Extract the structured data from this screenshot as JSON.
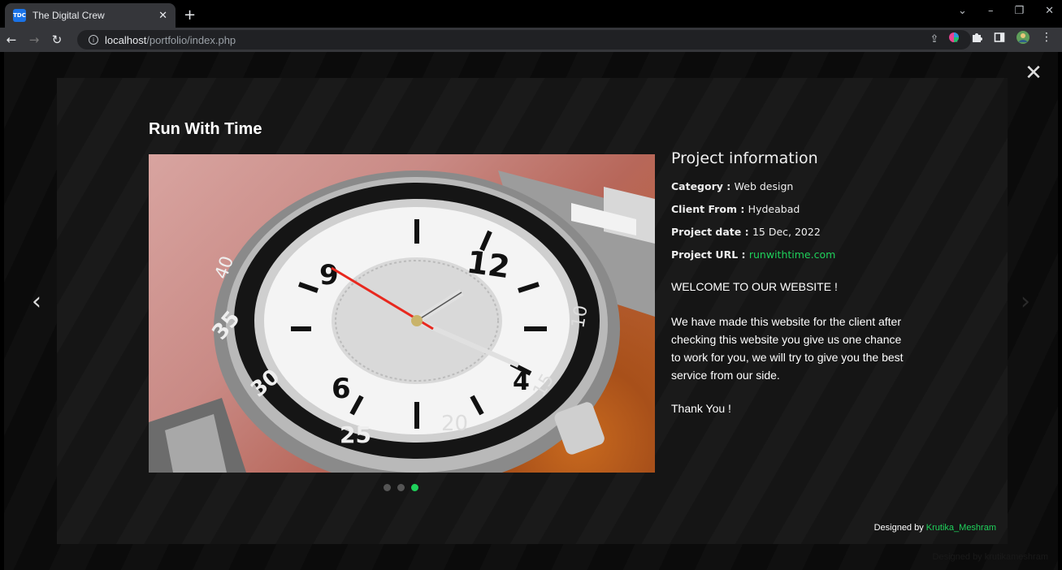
{
  "browser": {
    "tab_title": "The Digital Crew",
    "favicon_text": "TDC",
    "url_host": "localhost",
    "url_path": "/portfolio/index.php"
  },
  "portfolio_modal": {
    "title": "Run With Time",
    "info_heading": "Project information",
    "fields": [
      {
        "label": "Category",
        "value": "Web design"
      },
      {
        "label": "Client From",
        "value": "Hydeabad"
      },
      {
        "label": "Project date",
        "value": "15 Dec, 2022"
      },
      {
        "label": "Project URL",
        "value": "runwithtime.com"
      }
    ],
    "welcome": "WELCOME TO OUR WEBSITE !",
    "description": "We have made this website for the client after checking this website you give us one chance to work for you, we will try to give you the best service from our side.",
    "thanks": "Thank You !",
    "carousel": {
      "total": 3,
      "active_index": 2
    },
    "credit_prefix": "Designed by ",
    "credit_name": "Krutika_Meshram"
  },
  "page_behind": {
    "credit_prefix": "Designed by ",
    "credit_name": "krutikameshram"
  },
  "colors": {
    "accent": "#1fd15b"
  }
}
